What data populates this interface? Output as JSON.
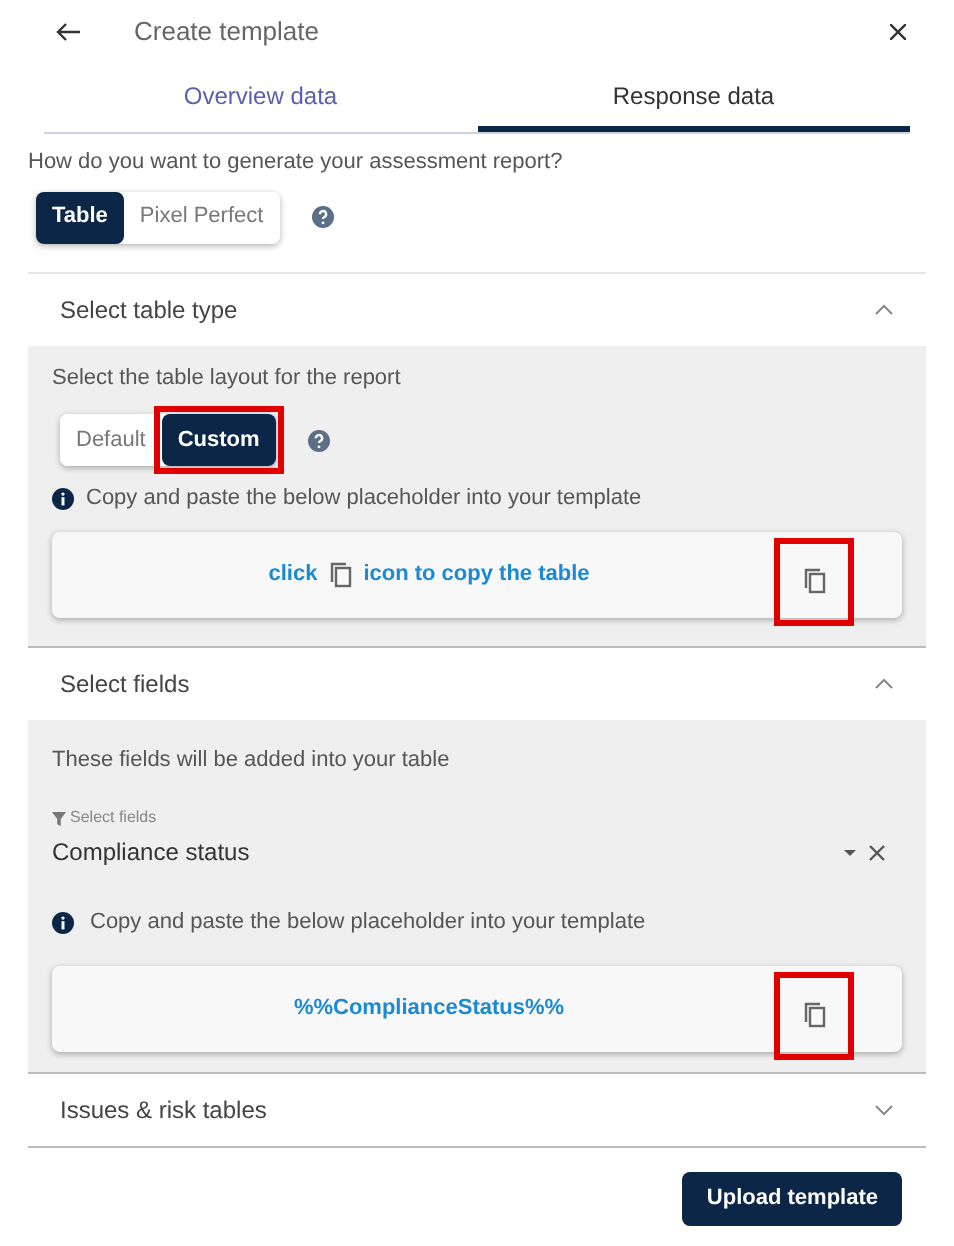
{
  "header": {
    "title": "Create template"
  },
  "tabs": [
    {
      "label": "Overview data",
      "selected": false
    },
    {
      "label": "Response data",
      "selected": true
    }
  ],
  "report_question": "How do you want to generate your assessment report?",
  "report_modes": [
    {
      "label": "Table",
      "selected": true
    },
    {
      "label": "Pixel Perfect",
      "selected": false
    }
  ],
  "sections": [
    {
      "kind": "table_type",
      "title": "Select table type",
      "expanded": true,
      "hint": "Select the table layout for the report",
      "options": [
        {
          "label": "Default",
          "selected": false,
          "highlighted": false
        },
        {
          "label": "Custom",
          "selected": true,
          "highlighted": true
        }
      ],
      "info": "Copy and paste the below placeholder into your template",
      "placeholder_parts": [
        "click",
        "icon to copy the table"
      ],
      "copy_highlighted": true
    },
    {
      "kind": "fields",
      "title": "Select fields",
      "expanded": true,
      "hint": "These fields will be added into your table",
      "field_label": "Select fields",
      "field_value": "Compliance status",
      "info": "Copy and paste the below placeholder into your template",
      "placeholder_parts": [
        "%%ComplianceStatus%%"
      ],
      "copy_highlighted": true
    },
    {
      "title": "Issues & risk tables",
      "expanded": false
    }
  ],
  "upload_button": "Upload template"
}
